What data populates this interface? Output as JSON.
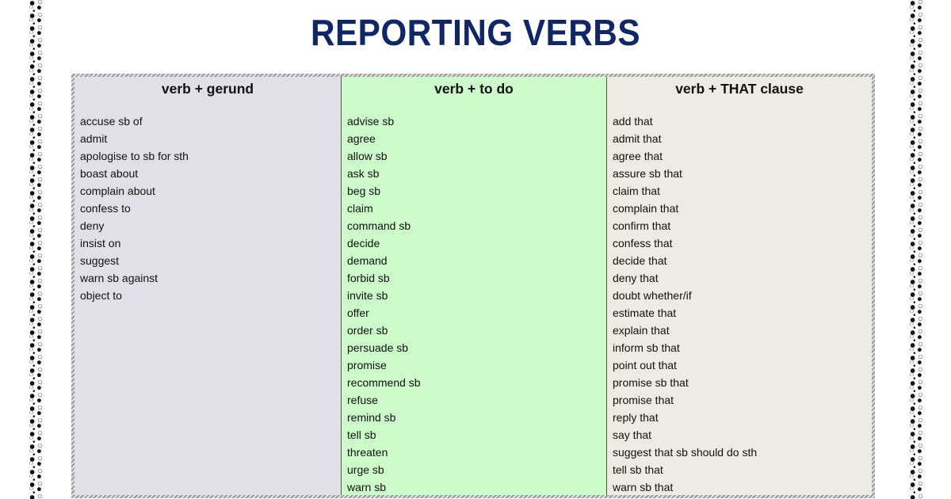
{
  "title": "REPORTING VERBS",
  "colors": {
    "title": "#102766",
    "gerund_bg": "#e3dfe9",
    "todo_bg": "#ccfcc9",
    "that_bg": "#edebe2"
  },
  "decoration": {
    "left_border_icon": "triangle-pattern-border",
    "right_border_icon": "triangle-pattern-border"
  },
  "columns": [
    {
      "header": "verb + gerund",
      "items": [
        "accuse sb of",
        "admit",
        "apologise to sb for sth",
        "boast about",
        "complain about",
        "confess to",
        "deny",
        "insist on",
        "suggest",
        "warn sb against",
        "object to"
      ]
    },
    {
      "header": "verb + to do",
      "items": [
        "advise sb",
        "agree",
        "allow sb",
        "ask sb",
        "beg sb",
        "claim",
        "command sb",
        "decide",
        "demand",
        "forbid sb",
        "invite sb",
        "offer",
        "order sb",
        "persuade sb",
        "promise",
        "recommend sb",
        "refuse",
        "remind sb",
        "tell sb",
        "threaten",
        "urge sb",
        "warn sb"
      ]
    },
    {
      "header": "verb + THAT clause",
      "items": [
        "add that",
        "admit that",
        "agree that",
        "assure sb that",
        "claim that",
        "complain that",
        "confirm that",
        "confess that",
        "decide that",
        "deny that",
        "doubt whether/if",
        "estimate that",
        "explain that",
        "inform sb that",
        "point out that",
        "promise sb that",
        "promise that",
        "reply that",
        "say that",
        "suggest that sb should do sth",
        "tell sb that",
        "warn sb that"
      ]
    }
  ]
}
